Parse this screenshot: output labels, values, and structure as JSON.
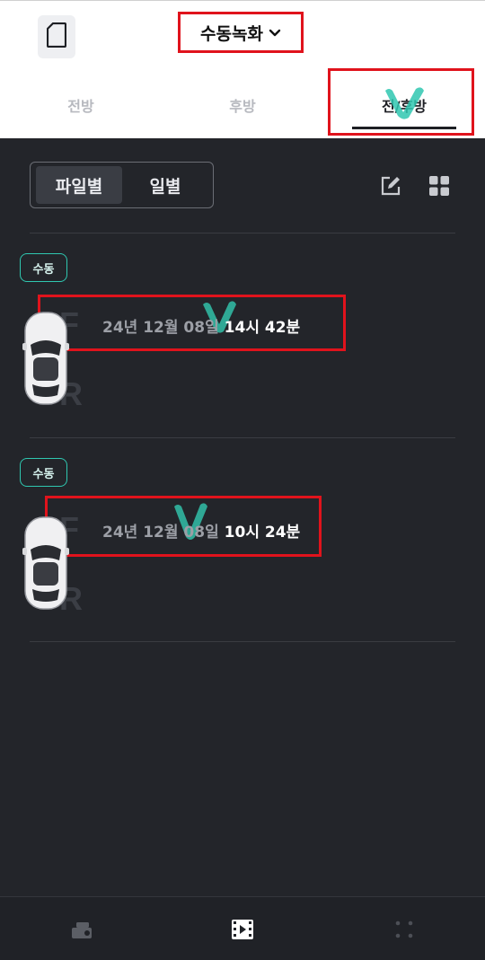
{
  "header": {
    "mode_label": "수동녹화",
    "tabs": [
      {
        "label": "전방",
        "active": false
      },
      {
        "label": "후방",
        "active": false
      },
      {
        "label": "전/후방",
        "active": true
      }
    ]
  },
  "toolbar": {
    "segments": [
      {
        "label": "파일별",
        "active": true
      },
      {
        "label": "일별",
        "active": false
      }
    ],
    "icons": [
      "edit-icon",
      "grid-view-icon"
    ]
  },
  "recordings": [
    {
      "badge": "수동",
      "date": "24년 12월 08일",
      "time": "14시 42분",
      "front": "F",
      "rear": "R"
    },
    {
      "badge": "수동",
      "date": "24년 12월 08일",
      "time": "10시 24분",
      "front": "F",
      "rear": "R"
    }
  ],
  "bottom_nav": [
    {
      "icon": "dashcam-icon",
      "active": false
    },
    {
      "icon": "video-list-icon",
      "active": true
    },
    {
      "icon": "more-dots-icon",
      "active": false
    }
  ],
  "colors": {
    "accent": "#2fc7b0",
    "annotation_red": "#e0131c",
    "background": "#23252a"
  }
}
